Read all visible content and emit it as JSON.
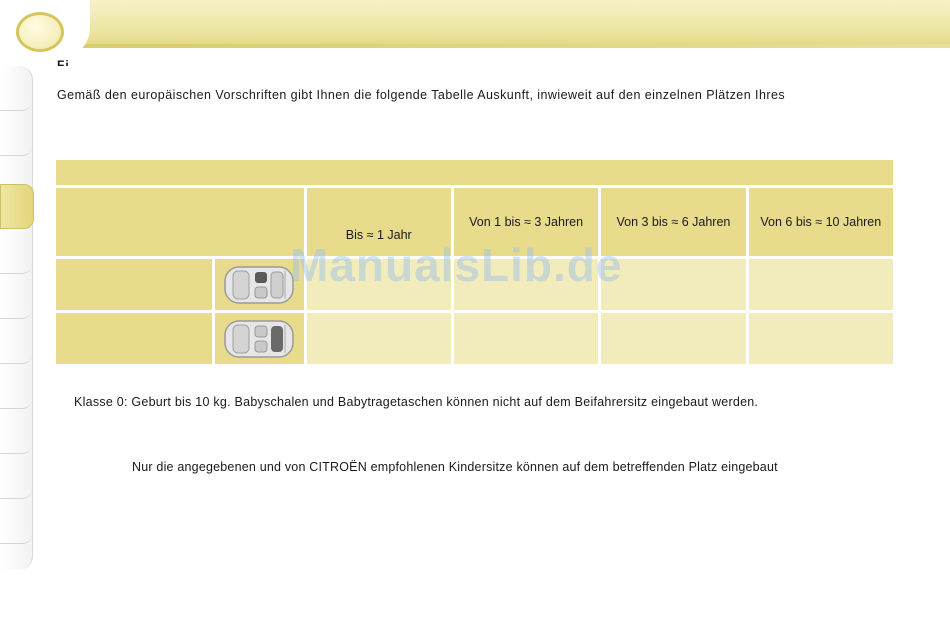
{
  "header": {
    "title": "Fi"
  },
  "intro": "Gemäß den europäischen Vorschriften gibt Ihnen die folgende Tabelle Auskunft, inwieweit auf den einzelnen Plätzen Ihres",
  "table": {
    "columns": [
      "Bis ≈ 1 Jahr",
      "Von 1 bis ≈ 3 Jahren",
      "Von 3 bis ≈ 6 Jahren",
      "Von 6 bis ≈ 10 Jahren"
    ],
    "rows": [
      {
        "icon": "car-front-seat-icon"
      },
      {
        "icon": "car-rear-seat-icon"
      }
    ]
  },
  "notes": {
    "class0": "Klasse 0: Geburt bis 10 kg. Babyschalen und Babytragetaschen können nicht auf dem Beifahrersitz eingebaut werden.",
    "citroen": "Nur die angegebenen und von CITROËN empfohlenen Kindersitze können auf dem betreffenden Platz eingebaut"
  },
  "watermark": "ManualsLib.de",
  "colors": {
    "accent": "#e8dc8c",
    "cell_light": "#f2ebbc",
    "watermark": "#96bee b"
  }
}
